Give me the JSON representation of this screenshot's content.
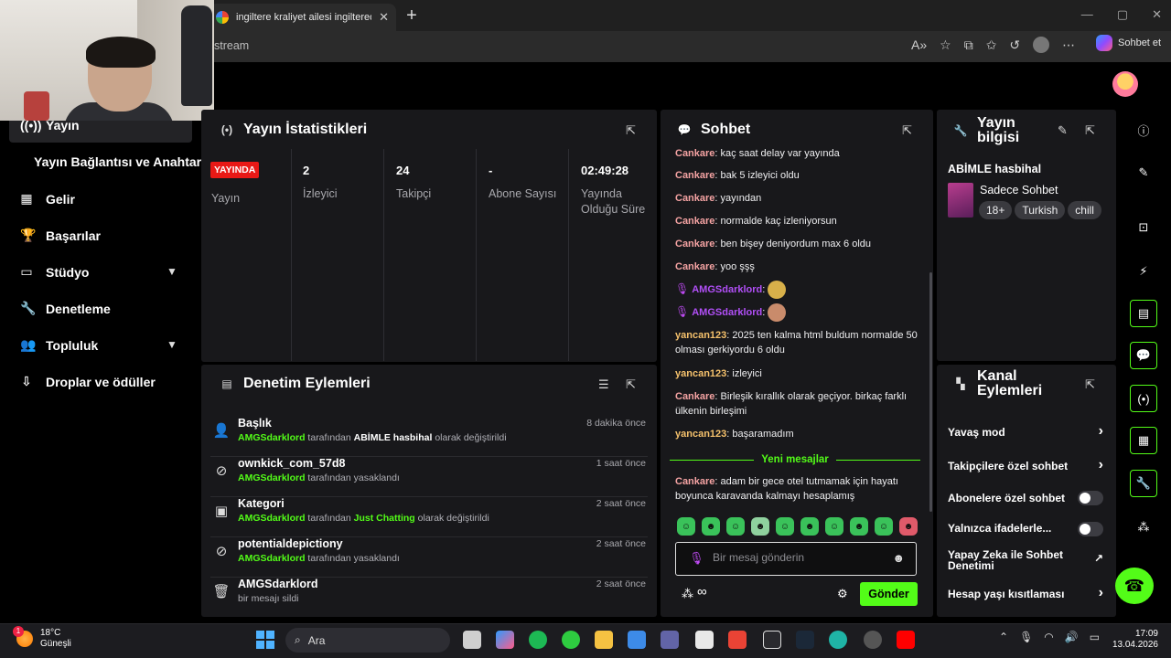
{
  "browser": {
    "tab_title": "ingiltere kraliyet ailesi ingilterede",
    "tab_close": "✕",
    "new_tab": "+",
    "url": "stream",
    "copilot_label": "Sohbet et",
    "window_controls": [
      "—",
      "▢",
      "✕"
    ]
  },
  "nav": {
    "items": [
      {
        "label": "Yayın",
        "icon": "broadcast-icon"
      },
      {
        "label": "Yayın Bağlantısı ve Anahtarı",
        "icon": ""
      },
      {
        "label": "Gelir",
        "icon": "revenue-icon"
      },
      {
        "label": "Başarılar",
        "icon": "trophy-icon"
      },
      {
        "label": "Stüdyo",
        "icon": "studio-icon"
      },
      {
        "label": "Denetleme",
        "icon": "wrench-icon"
      },
      {
        "label": "Topluluk",
        "icon": "community-icon"
      },
      {
        "label": "Droplar ve ödüller",
        "icon": "drops-icon"
      }
    ]
  },
  "stats": {
    "title": "Yayın İstatistikleri",
    "live_badge": "YAYINDA",
    "status_label": "Yayın",
    "viewers": {
      "value": "2",
      "label": "İzleyici"
    },
    "followers": {
      "value": "24",
      "label": "Takipçi"
    },
    "subs": {
      "value": "-",
      "label": "Abone Sayısı"
    },
    "uptime": {
      "value": "02:49:28",
      "label": "Yayında Olduğu Süre"
    }
  },
  "moderation": {
    "title": "Denetim Eylemleri",
    "rows": [
      {
        "icon": "user-edit-icon",
        "title": "Başlık",
        "actor": "AMGSdarklord",
        "middle": " tarafından ",
        "target": "ABİMLE hasbihal",
        "suffix": " olarak değiştirildi",
        "time": "8 dakika önce"
      },
      {
        "icon": "ban-icon",
        "title": "ownkick_com_57d8",
        "actor": "AMGSdarklord",
        "middle": " tarafından yasaklandı",
        "target": "",
        "suffix": "",
        "time": "1 saat önce"
      },
      {
        "icon": "category-icon",
        "title": "Kategori",
        "actor": "AMGSdarklord",
        "middle": " tarafından ",
        "target": "Just Chatting",
        "suffix": " olarak değiştirildi",
        "time": "2 saat önce"
      },
      {
        "icon": "ban-icon",
        "title": "potentialdepictiony",
        "actor": "AMGSdarklord",
        "middle": " tarafından yasaklandı",
        "target": "",
        "suffix": "",
        "time": "2 saat önce"
      },
      {
        "icon": "trash-icon",
        "title": "AMGSdarklord",
        "actor": "",
        "middle": "bir mesajı sildi",
        "target": "",
        "suffix": "",
        "time": "2 saat önce"
      }
    ]
  },
  "chat": {
    "title": "Sohbet",
    "messages": [
      {
        "user": "Cankare",
        "text": " kaç saat delay var yayında"
      },
      {
        "user": "Cankare",
        "text": " bak 5 izleyici oldu"
      },
      {
        "user": "Cankare",
        "text": " yayından"
      },
      {
        "user": "Cankare",
        "text": " normalde kaç izleniyorsun"
      },
      {
        "user": "Cankare",
        "text": " ben bişey deniyordum max 6 oldu"
      },
      {
        "user": "Cankare",
        "text": " yoo şşş"
      },
      {
        "user": "AMGSdarklord",
        "text": ""
      },
      {
        "user": "AMGSdarklord",
        "text": ""
      },
      {
        "user": "yancan123",
        "text": " 2025 ten kalma html buldum normalde 50 olması gerkiyordu 6 oldu"
      },
      {
        "user": "yancan123",
        "text": " izleyici"
      },
      {
        "user": "Cankare",
        "text": " Birleşik kırallık olarak geçiyor. birkaç farklı ülkenin birleşimi"
      },
      {
        "user": "yancan123",
        "text": " başaramadım"
      },
      {
        "user": "Cankare",
        "text": " adam bir gece otel tutmamak için hayatı boyunca karavanda kalmayı hesaplamış"
      }
    ],
    "new_messages_label": "Yeni mesajlar",
    "input_placeholder": "Bir mesaj gönderin",
    "send_label": "Gönder",
    "infinity": "∞"
  },
  "stream_info": {
    "title": "Yayın bilgisi",
    "stream_title": "ABİMLE hasbihal",
    "category": "Sadece Sohbet",
    "tags": [
      "18+",
      "Turkish",
      "chill"
    ]
  },
  "channel_actions": {
    "title": "Kanal Eylemleri",
    "items": [
      {
        "label": "Yavaş mod",
        "control": "arrow"
      },
      {
        "label": "Takipçilere özel sohbet",
        "control": "arrow"
      },
      {
        "label": "Abonelere özel sohbet",
        "control": "toggle"
      },
      {
        "label": "Yalnızca ifadelerle...",
        "control": "toggle"
      },
      {
        "label": "Yapay Zeka ile Sohbet Denetimi",
        "control": "external"
      },
      {
        "label": "Hesap yaşı kısıtlaması",
        "control": "arrow"
      }
    ]
  },
  "taskbar": {
    "weather_temp": "18°C",
    "weather_desc": "Güneşli",
    "weather_badge": "1",
    "search_label": "Ara",
    "time": "17:09",
    "date": "13.04.2026"
  }
}
